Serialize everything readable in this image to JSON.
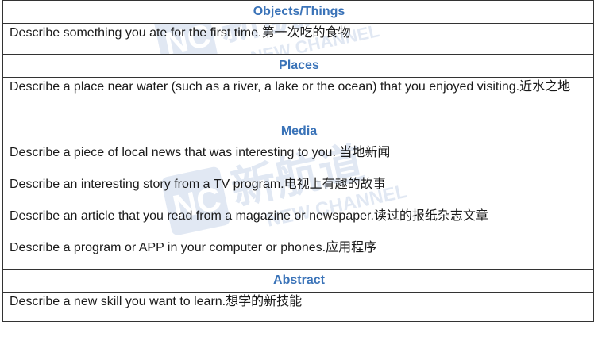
{
  "watermark": {
    "brand_text": "新航道",
    "brand_sub": "NEW CHANNEL",
    "logo_letters": "NC",
    "color": "#c9d6ea"
  },
  "sections": [
    {
      "header": "Objects/Things",
      "items": [
        "Describe something you ate for the first time.第一次吃的食物"
      ]
    },
    {
      "header": "Places",
      "items": [
        "Describe a place near water (such as a river, a lake or the ocean) that you enjoyed visiting.近水之地"
      ]
    },
    {
      "header": "Media",
      "items": [
        "Describe a piece of local news that was interesting to you.  当地新闻",
        "Describe an interesting story from a TV program.电视上有趣的故事",
        "Describe an article that you read from a magazine or newspaper.读过的报纸杂志文章",
        "Describe a program or APP in your computer or phones.应用程序"
      ]
    },
    {
      "header": "Abstract",
      "items": [
        "Describe a new skill you want to learn.想学的新技能"
      ]
    }
  ],
  "colors": {
    "header_text": "#3a73b8",
    "border": "#333333"
  }
}
